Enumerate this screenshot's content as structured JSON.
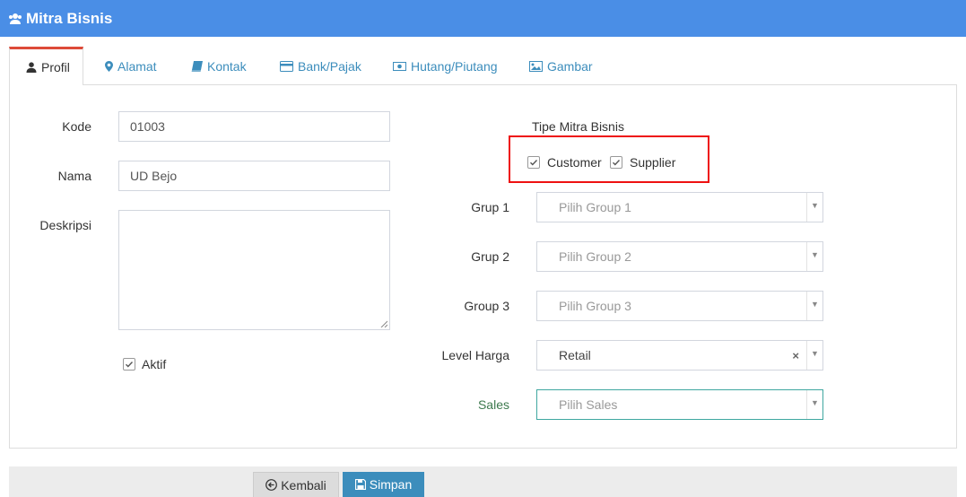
{
  "header": {
    "title": "Mitra Bisnis",
    "icon": "users-icon"
  },
  "tabs": [
    {
      "label": "Profil",
      "icon": "user-icon",
      "active": true
    },
    {
      "label": "Alamat",
      "icon": "map-marker-icon"
    },
    {
      "label": "Kontak",
      "icon": "book-icon"
    },
    {
      "label": "Bank/Pajak",
      "icon": "credit-card-icon"
    },
    {
      "label": "Hutang/Piutang",
      "icon": "money-icon"
    },
    {
      "label": "Gambar",
      "icon": "image-icon"
    }
  ],
  "form": {
    "kode": {
      "label": "Kode",
      "value": "01003"
    },
    "nama": {
      "label": "Nama",
      "value": "UD Bejo"
    },
    "deskripsi": {
      "label": "Deskripsi",
      "value": ""
    },
    "aktif": {
      "label": "Aktif",
      "checked": true
    },
    "tipe": {
      "label": "Tipe Mitra Bisnis",
      "customer": {
        "label": "Customer",
        "checked": true
      },
      "supplier": {
        "label": "Supplier",
        "checked": true
      }
    },
    "group1": {
      "label": "Grup 1",
      "placeholder": "Pilih Group 1"
    },
    "group2": {
      "label": "Grup 2",
      "placeholder": "Pilih Group 2"
    },
    "group3": {
      "label": "Group 3",
      "placeholder": "Pilih Group 3"
    },
    "level_harga": {
      "label": "Level Harga",
      "value": "Retail",
      "clear": "×"
    },
    "sales": {
      "label": "Sales",
      "placeholder": "Pilih Sales"
    }
  },
  "buttons": {
    "back": "Kembali",
    "save": "Simpan"
  },
  "colors": {
    "header": "#4a8ee6",
    "accent": "#3c8dbc",
    "highlight": "#e11111",
    "sales_focus": "#3fa7a0"
  }
}
